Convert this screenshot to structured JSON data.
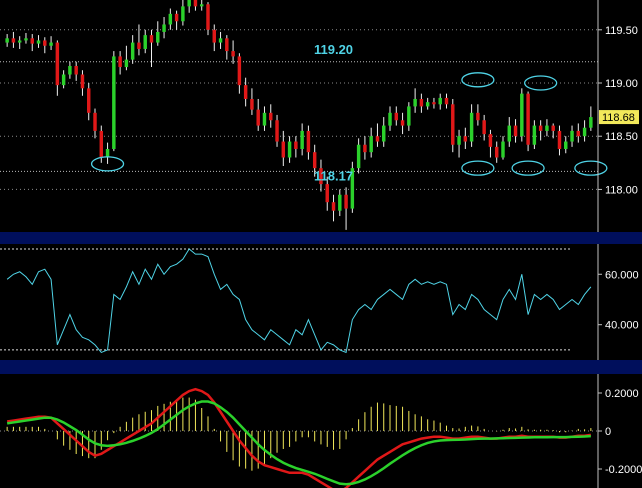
{
  "colors": {
    "background": "#000000",
    "separator": "#000f5c",
    "up_candle": "#2bd12b",
    "down_candle": "#e01818",
    "wick": "#f0f0f0",
    "rsi_line": "#4fd3e6",
    "macd_line": "#e01818",
    "signal_line": "#2bd12b",
    "histogram": "#f2e85a",
    "annotation": "#4fd3e6",
    "price_tag": "#f2e85a",
    "grid_dots": "#8a8a8a",
    "axis_line": "#c0c0c0"
  },
  "chart_data": [
    {
      "type": "candlestick",
      "panel": "price",
      "ylim": [
        117.6,
        119.78
      ],
      "yticks": [
        "119.50",
        "119.00",
        "118.50",
        "118.00"
      ],
      "ytick_values": [
        119.5,
        119.0,
        118.5,
        118.0
      ],
      "last_price_label": "118.68",
      "last_price": 118.68,
      "reference_lines": [
        119.2,
        118.17
      ],
      "annotations": [
        {
          "text": "119.20",
          "x_index": 52,
          "y": 119.32
        },
        {
          "text": "118.17",
          "x_index": 52,
          "y": 118.13
        }
      ],
      "markers": [
        {
          "shape": "ellipse",
          "x_index": 16,
          "y": 118.24
        },
        {
          "shape": "ellipse",
          "x_index": 75,
          "y": 119.03
        },
        {
          "shape": "ellipse",
          "x_index": 85,
          "y": 119.0
        },
        {
          "shape": "ellipse",
          "x_index": 75,
          "y": 118.2
        },
        {
          "shape": "ellipse",
          "x_index": 83,
          "y": 118.2
        },
        {
          "shape": "ellipse",
          "x_index": 93,
          "y": 118.2
        }
      ],
      "candles": [
        [
          119.38,
          119.42,
          119.46,
          119.34
        ],
        [
          119.42,
          119.38,
          119.48,
          119.33
        ],
        [
          119.38,
          119.4,
          119.44,
          119.32
        ],
        [
          119.4,
          119.42,
          119.47,
          119.37
        ],
        [
          119.42,
          119.37,
          119.46,
          119.3
        ],
        [
          119.37,
          119.4,
          119.45,
          119.33
        ],
        [
          119.4,
          119.35,
          119.43,
          119.28
        ],
        [
          119.35,
          119.38,
          119.44,
          119.31
        ],
        [
          119.38,
          118.98,
          119.4,
          118.88
        ],
        [
          118.98,
          119.08,
          119.12,
          118.95
        ],
        [
          119.08,
          119.16,
          119.2,
          119.04
        ],
        [
          119.16,
          119.08,
          119.2,
          119.02
        ],
        [
          119.08,
          118.95,
          119.12,
          118.88
        ],
        [
          118.95,
          118.72,
          119.0,
          118.65
        ],
        [
          118.72,
          118.55,
          118.76,
          118.48
        ],
        [
          118.55,
          118.3,
          118.6,
          118.25
        ],
        [
          118.3,
          118.38,
          118.44,
          118.24
        ],
        [
          118.38,
          119.25,
          119.3,
          118.36
        ],
        [
          119.25,
          119.15,
          119.3,
          119.08
        ],
        [
          119.15,
          119.22,
          119.35,
          119.12
        ],
        [
          119.22,
          119.38,
          119.45,
          119.18
        ],
        [
          119.38,
          119.32,
          119.55,
          119.26
        ],
        [
          119.32,
          119.45,
          119.5,
          119.28
        ],
        [
          119.45,
          119.38,
          119.5,
          119.15
        ],
        [
          119.38,
          119.48,
          119.58,
          119.35
        ],
        [
          119.48,
          119.55,
          119.62,
          119.42
        ],
        [
          119.55,
          119.65,
          119.7,
          119.5
        ],
        [
          119.65,
          119.58,
          119.68,
          119.5
        ],
        [
          119.58,
          119.72,
          119.78,
          119.54
        ],
        [
          119.72,
          119.78,
          119.8,
          119.66
        ],
        [
          119.78,
          119.72,
          119.8,
          119.68
        ],
        [
          119.72,
          119.74,
          119.78,
          119.68
        ],
        [
          119.74,
          119.5,
          119.76,
          119.45
        ],
        [
          119.5,
          119.38,
          119.55,
          119.3
        ],
        [
          119.38,
          119.42,
          119.48,
          119.32
        ],
        [
          119.42,
          119.3,
          119.45,
          119.22
        ],
        [
          119.3,
          119.25,
          119.4,
          119.18
        ],
        [
          119.25,
          118.98,
          119.28,
          118.9
        ],
        [
          118.98,
          118.85,
          119.05,
          118.78
        ],
        [
          118.85,
          118.75,
          118.95,
          118.7
        ],
        [
          118.75,
          118.6,
          118.85,
          118.55
        ],
        [
          118.6,
          118.72,
          118.78,
          118.55
        ],
        [
          118.72,
          118.65,
          118.8,
          118.58
        ],
        [
          118.65,
          118.45,
          118.7,
          118.4
        ],
        [
          118.45,
          118.3,
          118.55,
          118.22
        ],
        [
          118.3,
          118.45,
          118.5,
          118.25
        ],
        [
          118.45,
          118.38,
          118.5,
          118.3
        ],
        [
          118.38,
          118.55,
          118.62,
          118.32
        ],
        [
          118.55,
          118.35,
          118.6,
          118.28
        ],
        [
          118.35,
          118.2,
          118.42,
          118.12
        ],
        [
          118.2,
          118.05,
          118.28,
          117.98
        ],
        [
          118.05,
          117.88,
          118.12,
          117.8
        ],
        [
          117.88,
          117.8,
          117.95,
          117.7
        ],
        [
          117.8,
          117.95,
          118.0,
          117.75
        ],
        [
          117.95,
          117.82,
          118.02,
          117.62
        ],
        [
          117.82,
          118.2,
          118.26,
          117.78
        ],
        [
          118.2,
          118.42,
          118.48,
          118.15
        ],
        [
          118.42,
          118.35,
          118.5,
          118.28
        ],
        [
          118.35,
          118.5,
          118.58,
          118.3
        ],
        [
          118.5,
          118.45,
          118.62,
          118.4
        ],
        [
          118.45,
          118.6,
          118.68,
          118.4
        ],
        [
          118.6,
          118.72,
          118.78,
          118.55
        ],
        [
          118.72,
          118.65,
          118.78,
          118.6
        ],
        [
          118.65,
          118.6,
          118.72,
          118.52
        ],
        [
          118.6,
          118.78,
          118.82,
          118.55
        ],
        [
          118.78,
          118.85,
          118.95,
          118.72
        ],
        [
          118.85,
          118.78,
          118.9,
          118.72
        ],
        [
          118.78,
          118.82,
          118.86,
          118.75
        ],
        [
          118.82,
          118.8,
          118.86,
          118.76
        ],
        [
          118.8,
          118.86,
          118.9,
          118.75
        ],
        [
          118.86,
          118.8,
          118.9,
          118.76
        ],
        [
          118.8,
          118.42,
          118.85,
          118.35
        ],
        [
          118.42,
          118.5,
          118.56,
          118.3
        ],
        [
          118.5,
          118.45,
          118.58,
          118.38
        ],
        [
          118.45,
          118.72,
          118.8,
          118.4
        ],
        [
          118.72,
          118.65,
          118.8,
          118.6
        ],
        [
          118.65,
          118.52,
          118.7,
          118.46
        ],
        [
          118.52,
          118.4,
          118.56,
          118.3
        ],
        [
          118.4,
          118.3,
          118.45,
          118.25
        ],
        [
          118.3,
          118.45,
          118.5,
          118.28
        ],
        [
          118.45,
          118.6,
          118.68,
          118.4
        ],
        [
          118.6,
          118.5,
          118.66,
          118.44
        ],
        [
          118.5,
          118.9,
          118.95,
          118.45
        ],
        [
          118.9,
          118.42,
          118.92,
          118.36
        ],
        [
          118.42,
          118.6,
          118.65,
          118.38
        ],
        [
          118.6,
          118.55,
          118.65,
          118.46
        ],
        [
          118.55,
          118.6,
          118.66,
          118.5
        ],
        [
          118.6,
          118.55,
          118.62,
          118.48
        ],
        [
          118.55,
          118.38,
          118.6,
          118.32
        ],
        [
          118.38,
          118.45,
          118.5,
          118.34
        ],
        [
          118.45,
          118.55,
          118.6,
          118.4
        ],
        [
          118.55,
          118.5,
          118.62,
          118.44
        ],
        [
          118.5,
          118.58,
          118.65,
          118.45
        ],
        [
          118.58,
          118.68,
          118.78,
          118.55
        ]
      ]
    },
    {
      "type": "line",
      "panel": "rsi",
      "ylim": [
        26,
        72
      ],
      "yticks": [
        "60.000",
        "40.000"
      ],
      "ytick_values": [
        60,
        40
      ],
      "reference_lines": [
        70,
        30
      ],
      "values": [
        58,
        60,
        61,
        59,
        56,
        61,
        62,
        58,
        32,
        38,
        44,
        38,
        35,
        34,
        32,
        29,
        30,
        52,
        50,
        55,
        61,
        56,
        62,
        58,
        64,
        60,
        63,
        64,
        66,
        70,
        68,
        68,
        67,
        60,
        54,
        56,
        52,
        50,
        42,
        38,
        36,
        34,
        38,
        36,
        34,
        32,
        38,
        36,
        42,
        36,
        30,
        33,
        32,
        30,
        29,
        42,
        46,
        48,
        46,
        50,
        52,
        54,
        52,
        50,
        56,
        58,
        56,
        57,
        56,
        57,
        56,
        44,
        48,
        46,
        52,
        50,
        46,
        44,
        42,
        50,
        54,
        50,
        60,
        44,
        52,
        50,
        52,
        50,
        46,
        48,
        50,
        48,
        52,
        55
      ]
    },
    {
      "type": "line",
      "panel": "macd",
      "ylim": [
        -0.3,
        0.3
      ],
      "yticks": [
        "0.2000",
        "0",
        "-0.2000"
      ],
      "ytick_values": [
        0.2,
        0,
        -0.2
      ],
      "series": [
        {
          "values": [
            0.05,
            0.055,
            0.06,
            0.065,
            0.07,
            0.075,
            0.075,
            0.07,
            0.04,
            0.01,
            -0.02,
            -0.05,
            -0.08,
            -0.11,
            -0.13,
            -0.12,
            -0.1,
            -0.08,
            -0.06,
            -0.04,
            -0.02,
            0.0,
            0.02,
            0.04,
            0.07,
            0.1,
            0.13,
            0.16,
            0.19,
            0.21,
            0.22,
            0.21,
            0.19,
            0.15,
            0.1,
            0.05,
            0.0,
            -0.05,
            -0.09,
            -0.13,
            -0.16,
            -0.18,
            -0.19,
            -0.2,
            -0.21,
            -0.22,
            -0.22,
            -0.22,
            -0.23,
            -0.25,
            -0.27,
            -0.29,
            -0.31,
            -0.32,
            -0.3,
            -0.27,
            -0.24,
            -0.21,
            -0.18,
            -0.15,
            -0.13,
            -0.11,
            -0.09,
            -0.07,
            -0.06,
            -0.05,
            -0.04,
            -0.035,
            -0.03,
            -0.03,
            -0.035,
            -0.04,
            -0.04,
            -0.035,
            -0.03,
            -0.03,
            -0.035,
            -0.04,
            -0.04,
            -0.035,
            -0.03,
            -0.03,
            -0.025,
            -0.03,
            -0.03,
            -0.03,
            -0.03,
            -0.03,
            -0.035,
            -0.035,
            -0.03,
            -0.025,
            -0.025,
            -0.02
          ]
        },
        {
          "values": [
            0.04,
            0.045,
            0.05,
            0.055,
            0.06,
            0.065,
            0.07,
            0.07,
            0.06,
            0.045,
            0.025,
            0.005,
            -0.02,
            -0.045,
            -0.065,
            -0.075,
            -0.078,
            -0.075,
            -0.07,
            -0.062,
            -0.052,
            -0.04,
            -0.026,
            -0.01,
            0.01,
            0.035,
            0.06,
            0.085,
            0.11,
            0.13,
            0.145,
            0.155,
            0.155,
            0.145,
            0.125,
            0.1,
            0.07,
            0.035,
            0.0,
            -0.035,
            -0.07,
            -0.1,
            -0.125,
            -0.148,
            -0.167,
            -0.182,
            -0.195,
            -0.205,
            -0.215,
            -0.225,
            -0.238,
            -0.252,
            -0.265,
            -0.277,
            -0.28,
            -0.277,
            -0.268,
            -0.255,
            -0.238,
            -0.218,
            -0.196,
            -0.172,
            -0.15,
            -0.128,
            -0.108,
            -0.09,
            -0.075,
            -0.063,
            -0.055,
            -0.05,
            -0.048,
            -0.047,
            -0.046,
            -0.045,
            -0.043,
            -0.041,
            -0.04,
            -0.04,
            -0.039,
            -0.038,
            -0.037,
            -0.036,
            -0.035,
            -0.034,
            -0.033,
            -0.033,
            -0.033,
            -0.032,
            -0.032,
            -0.032,
            -0.031,
            -0.03,
            -0.029,
            -0.027
          ]
        }
      ]
    }
  ]
}
